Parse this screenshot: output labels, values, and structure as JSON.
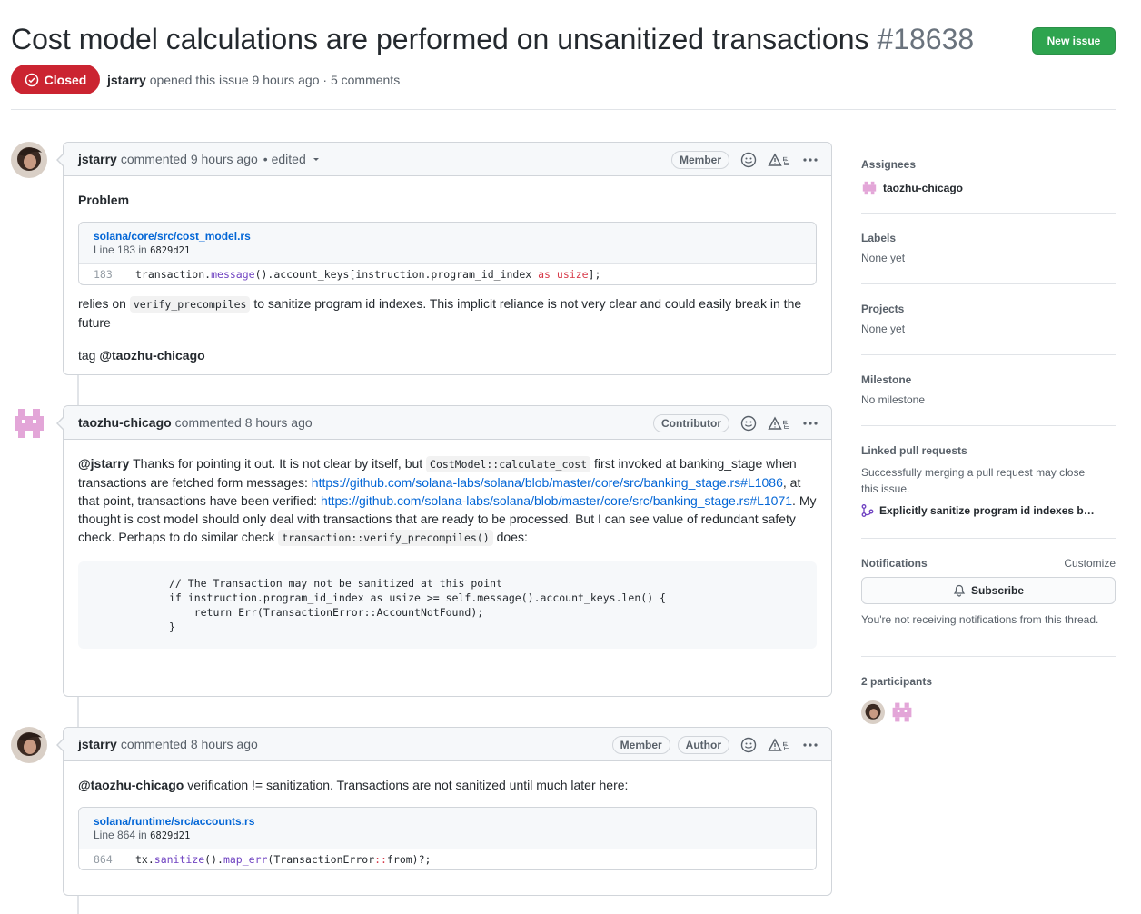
{
  "issue": {
    "title": "Cost model calculations are performed on unsanitized transactions",
    "number": "#18638",
    "new_issue_label": "New issue",
    "state": "Closed",
    "author": "jstarry",
    "meta_text": "opened this issue 9 hours ago · 5 comments"
  },
  "comments": [
    {
      "author": "jstarry",
      "time": "commented 9 hours ago",
      "edited": "• edited",
      "labels": [
        "Member"
      ],
      "problem": "Problem",
      "snippet": {
        "path": "solana/core/src/cost_model.rs",
        "line_info": "Line 183 in",
        "commit": "6829d21",
        "line_number": "183",
        "code_a": "transaction.",
        "code_fn": "message",
        "code_b": "().account_keys[instruction.program_id_index ",
        "code_as": "as",
        "code_c": " ",
        "code_type": "usize",
        "code_d": "];"
      },
      "text_a": "relies on",
      "code_inline": "verify_precompiles",
      "text_b": "to sanitize program id indexes. This implicit reliance is not very clear and could easily break in the future",
      "tag_text": "tag",
      "tag_mention": "@taozhu-chicago"
    },
    {
      "author": "taozhu-chicago",
      "time": "commented 8 hours ago",
      "labels": [
        "Contributor"
      ],
      "mention": "@jstarry",
      "text_a": "Thanks for pointing it out. It is not clear by itself, but",
      "code_a": "CostModel::calculate_cost",
      "text_b": "first invoked at banking_stage when transactions are fetched form messages:",
      "link_a": "https://github.com/solana-labs/solana/blob/master/core/src/banking_stage.rs#L1086",
      "text_c": ", at that point, transactions have been verified:",
      "link_b": "https://github.com/solana-labs/solana/blob/master/core/src/banking_stage.rs#L1071",
      "text_d": ". My thought is cost model should only deal with transactions that are ready to be processed. But I can see value of redundant safety check. Perhaps to do similar check",
      "code_b": "transaction::verify_precompiles()",
      "text_e": "does:",
      "code_block": "// The Transaction may not be sanitized at this point\nif instruction.program_id_index as usize >= self.message().account_keys.len() {\n    return Err(TransactionError::AccountNotFound);\n}"
    },
    {
      "author": "jstarry",
      "time": "commented 8 hours ago",
      "labels": [
        "Member",
        "Author"
      ],
      "mention": "@taozhu-chicago",
      "text": "verification != sanitization. Transactions are not sanitized until much later here:",
      "snippet": {
        "path": "solana/runtime/src/accounts.rs",
        "line_info": "Line 864 in",
        "commit": "6829d21",
        "line_number": "864",
        "code_a": "tx.",
        "code_fn": "sanitize",
        "code_b": "().",
        "code_fn2": "map_err",
        "code_c": "(TransactionError",
        "code_op": "::",
        "code_d": "from)?;"
      }
    }
  ],
  "sidebar": {
    "assignees_heading": "Assignees",
    "assignee": "taozhu-chicago",
    "labels_heading": "Labels",
    "labels_value": "None yet",
    "projects_heading": "Projects",
    "projects_value": "None yet",
    "milestone_heading": "Milestone",
    "milestone_value": "No milestone",
    "linked_heading": "Linked pull requests",
    "linked_desc": "Successfully merging a pull request may close this issue.",
    "linked_pr": "Explicitly sanitize program id indexes b…",
    "notifications_heading": "Notifications",
    "customize": "Customize",
    "subscribe": "Subscribe",
    "notif_desc": "You're not receiving notifications from this thread.",
    "participants_heading": "2 participants"
  },
  "colors": {
    "closed": "#cb2431",
    "new_issue": "#2ea44f",
    "link": "#0366d6",
    "identicon": "#e3a6d8"
  }
}
